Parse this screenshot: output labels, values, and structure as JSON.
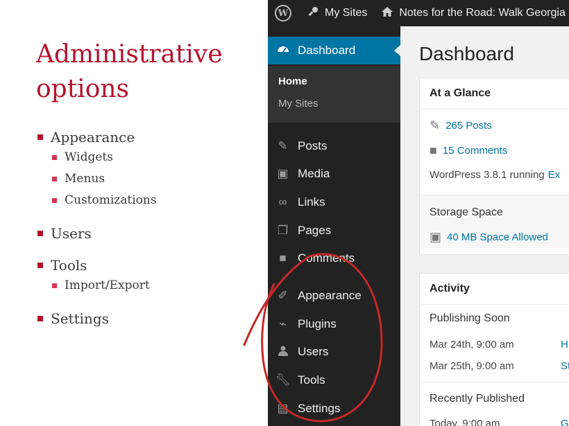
{
  "slide": {
    "title_line1": "Administrative",
    "title_line2": "options",
    "bullets": {
      "appearance": "Appearance",
      "widgets": "Widgets",
      "menus": "Menus",
      "customizations": "Customizations",
      "users": "Users",
      "tools": "Tools",
      "import_export": "Import/Export",
      "settings": "Settings"
    },
    "accent_color": "#b5122e"
  },
  "wp": {
    "admin_bar": {
      "logo": "W",
      "my_sites": "My Sites",
      "site_name": "Notes for the Road: Walk Georgia"
    },
    "sidebar": {
      "dashboard": "Dashboard",
      "submenu": {
        "home": "Home",
        "my_sites": "My Sites"
      },
      "items": [
        "Posts",
        "Media",
        "Links",
        "Pages",
        "Comments",
        "Appearance",
        "Plugins",
        "Users",
        "Tools",
        "Settings"
      ]
    },
    "main": {
      "heading": "Dashboard",
      "at_a_glance": {
        "title": "At a Glance",
        "posts": "265 Posts",
        "comments": "15 Comments",
        "version_text": "WordPress 3.8.1 running",
        "version_link": "Ex",
        "storage_title": "Storage Space",
        "storage_value": "40 MB Space Allowed"
      },
      "activity": {
        "title": "Activity",
        "publishing_soon": "Publishing Soon",
        "scheduled": [
          {
            "date": "Mar 24th, 9:00 am",
            "link": "H"
          },
          {
            "date": "Mar 25th, 9:00 am",
            "link": "St"
          }
        ],
        "recently_published": "Recently Published",
        "recent": [
          {
            "date": "Today, 9:00 am",
            "link": "G"
          }
        ]
      }
    },
    "colors": {
      "sidebar": "#222222",
      "current": "#0074a2",
      "link": "#0074a2",
      "annotation": "#c62828"
    }
  }
}
